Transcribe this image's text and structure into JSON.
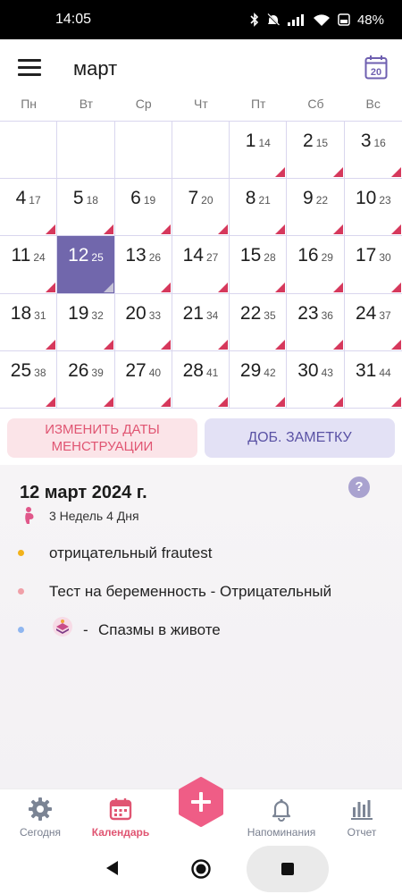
{
  "status_bar": {
    "time": "14:05",
    "battery": "48%"
  },
  "header": {
    "month_title": "март",
    "today_badge": "20"
  },
  "weekdays": [
    "Пн",
    "Вт",
    "Ср",
    "Чт",
    "Пт",
    "Сб",
    "Вс"
  ],
  "calendar": {
    "selected_day": "12",
    "rows": [
      [
        {
          "d": "",
          "c": ""
        },
        {
          "d": "",
          "c": ""
        },
        {
          "d": "",
          "c": ""
        },
        {
          "d": "",
          "c": ""
        },
        {
          "d": "1",
          "c": "14"
        },
        {
          "d": "2",
          "c": "15"
        },
        {
          "d": "3",
          "c": "16"
        }
      ],
      [
        {
          "d": "4",
          "c": "17"
        },
        {
          "d": "5",
          "c": "18"
        },
        {
          "d": "6",
          "c": "19"
        },
        {
          "d": "7",
          "c": "20"
        },
        {
          "d": "8",
          "c": "21"
        },
        {
          "d": "9",
          "c": "22"
        },
        {
          "d": "10",
          "c": "23"
        }
      ],
      [
        {
          "d": "11",
          "c": "24"
        },
        {
          "d": "12",
          "c": "25"
        },
        {
          "d": "13",
          "c": "26"
        },
        {
          "d": "14",
          "c": "27"
        },
        {
          "d": "15",
          "c": "28"
        },
        {
          "d": "16",
          "c": "29"
        },
        {
          "d": "17",
          "c": "30"
        }
      ],
      [
        {
          "d": "18",
          "c": "31"
        },
        {
          "d": "19",
          "c": "32"
        },
        {
          "d": "20",
          "c": "33"
        },
        {
          "d": "21",
          "c": "34"
        },
        {
          "d": "22",
          "c": "35"
        },
        {
          "d": "23",
          "c": "36"
        },
        {
          "d": "24",
          "c": "37"
        }
      ],
      [
        {
          "d": "25",
          "c": "38"
        },
        {
          "d": "26",
          "c": "39"
        },
        {
          "d": "27",
          "c": "40"
        },
        {
          "d": "28",
          "c": "41"
        },
        {
          "d": "29",
          "c": "42"
        },
        {
          "d": "30",
          "c": "43"
        },
        {
          "d": "31",
          "c": "44"
        }
      ]
    ]
  },
  "actions": {
    "edit_period_line1": "ИЗМЕНИТЬ ДАТЫ",
    "edit_period_line2": "МЕНСТРУАЦИИ",
    "add_note": "ДОБ. ЗАМЕТКУ"
  },
  "details": {
    "date_title": "12 март 2024 г.",
    "help_label": "?",
    "pregnancy_week": "3 Недель 4 Дня",
    "entries": [
      {
        "text": "отрицательный fraut​est",
        "color": "#f2b21b"
      },
      {
        "text": "Тест на беременность - Отрицательный",
        "color": "#f0a0a8"
      },
      {
        "dash": "-",
        "text": "Спазмы в животе",
        "color": "#8fb6f0"
      }
    ]
  },
  "bottom_nav": {
    "today": "Сегодня",
    "calendar": "Календарь",
    "reminders": "Напоминания",
    "report": "Отчет"
  },
  "colors": {
    "accent": "#7167ac",
    "period": "#d6385c",
    "fab": "#ef5d86"
  }
}
